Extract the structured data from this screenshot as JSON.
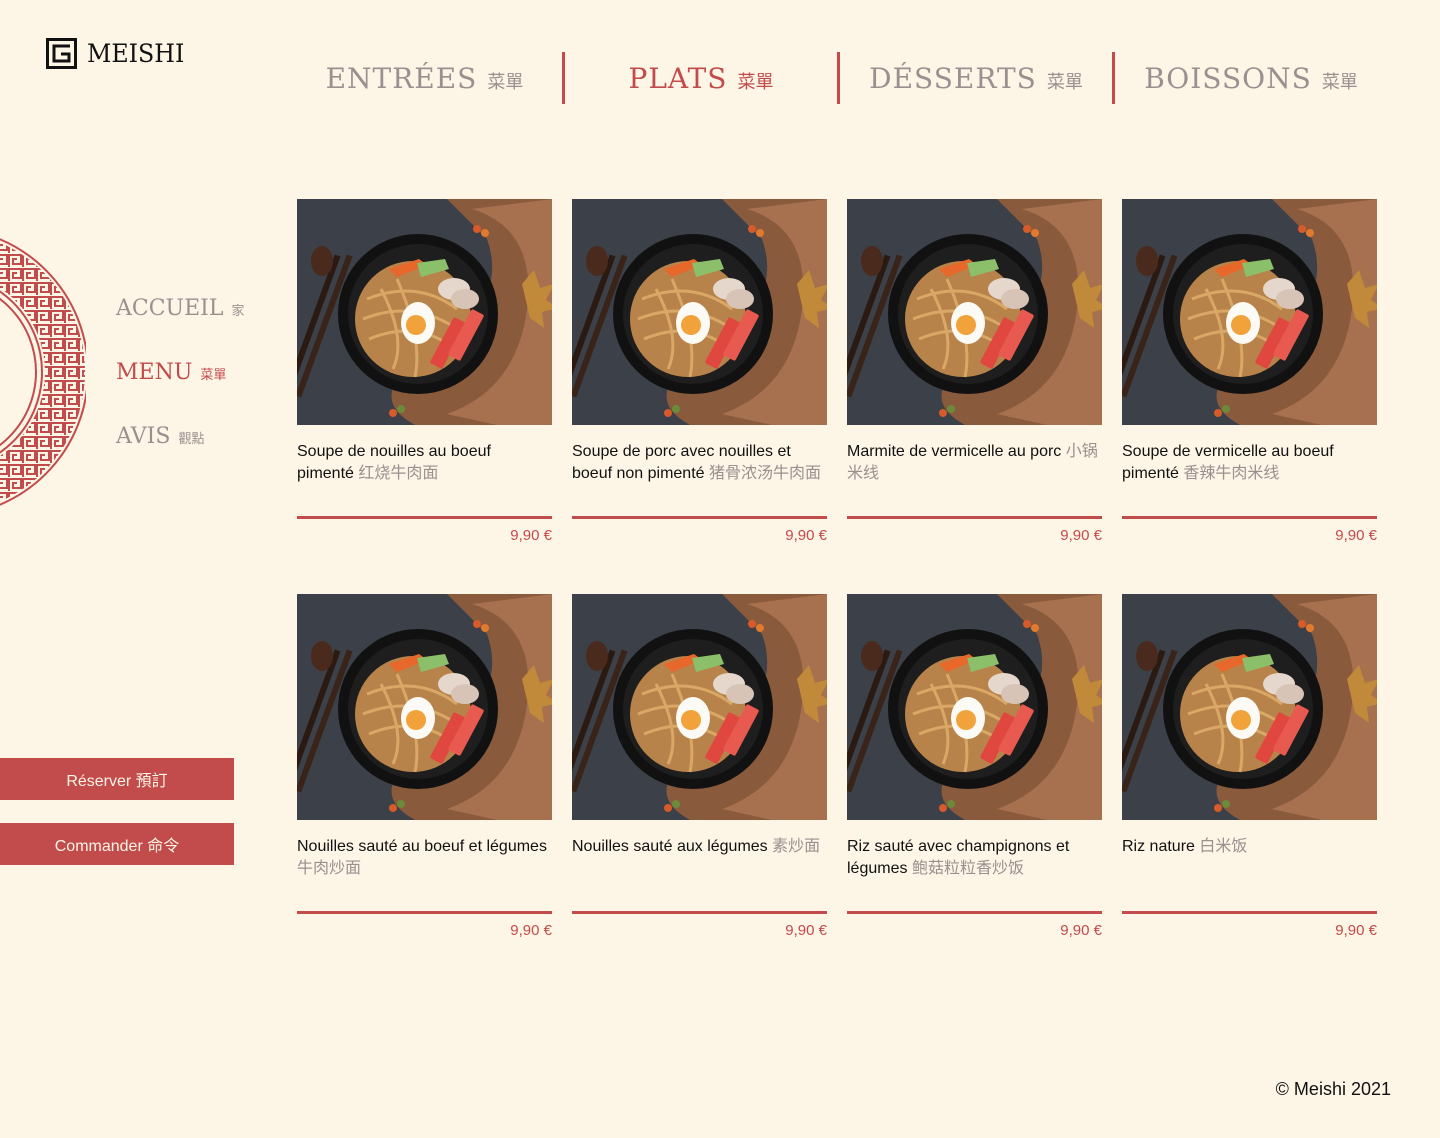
{
  "brand": {
    "name": "MEISHI"
  },
  "tabs": [
    {
      "label": "Entrées",
      "cn": "菜單",
      "active": false
    },
    {
      "label": "Plats",
      "cn": "菜單",
      "active": true
    },
    {
      "label": "Désserts",
      "cn": "菜單",
      "active": false
    },
    {
      "label": "Boissons",
      "cn": "菜單",
      "active": false
    }
  ],
  "side_nav": [
    {
      "label": "Accueil",
      "cn": "家",
      "active": false
    },
    {
      "label": "Menu",
      "cn": "菜單",
      "active": true
    },
    {
      "label": "Avis",
      "cn": "觀點",
      "active": false
    }
  ],
  "buttons": {
    "reserve": "Réserver 預訂",
    "order": "Commander 命令"
  },
  "dishes": [
    {
      "name": "Soupe de nouilles au boeuf pimenté",
      "cn": "红烧牛肉面",
      "price": "9,90 €"
    },
    {
      "name": "Soupe de porc avec nouilles et boeuf non pimenté",
      "cn": "猪骨浓汤牛肉面",
      "price": "9,90 €"
    },
    {
      "name": "Marmite de vermicelle au porc",
      "cn": "小锅米线",
      "price": "9,90 €"
    },
    {
      "name": "Soupe de vermicelle au boeuf pimenté",
      "cn": "香辣牛肉米线",
      "price": "9,90 €"
    },
    {
      "name": "Nouilles sauté au boeuf et légumes",
      "cn": "牛肉炒面",
      "price": "9,90 €"
    },
    {
      "name": "Nouilles sauté aux légumes",
      "cn": "素炒面",
      "price": "9,90 €"
    },
    {
      "name": "Riz sauté avec champignons et légumes",
      "cn": "鲍菇粒粒香炒饭",
      "price": "9,90 €"
    },
    {
      "name": "Riz nature",
      "cn": "白米饭",
      "price": "9,90 €"
    }
  ],
  "footer": {
    "copyright": "© Meishi 2021"
  },
  "colors": {
    "background": "#fdf5e6",
    "accent": "#c24b4b",
    "muted": "#9a9090"
  }
}
